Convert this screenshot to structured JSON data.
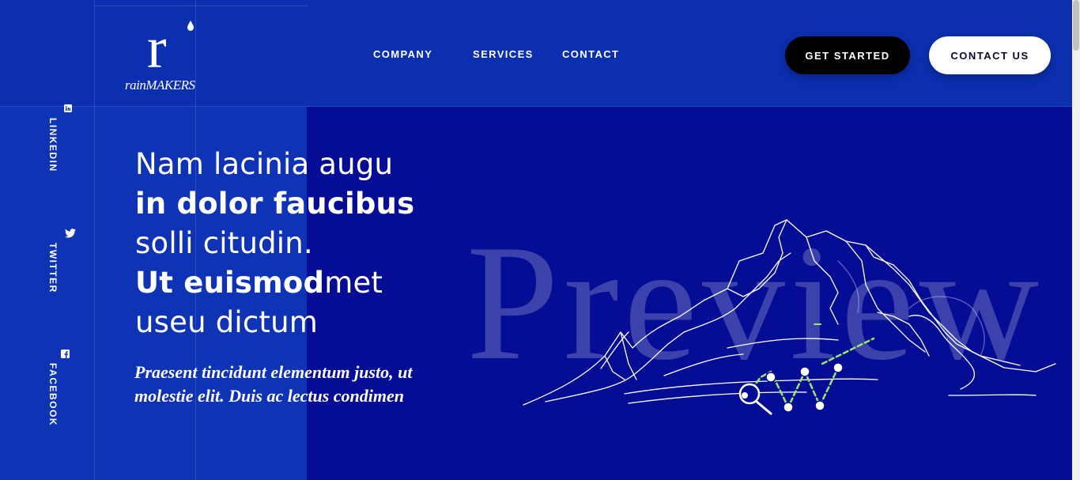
{
  "brand": {
    "logo_letter": "r",
    "logo_word": "rainMAKERS"
  },
  "nav": {
    "items": [
      "COMPANY",
      "SERVICES",
      "CONTACT"
    ]
  },
  "actions": {
    "get_started": "GET STARTED",
    "contact_us": "CONTACT US"
  },
  "social": [
    {
      "label": "LINKEDIN",
      "icon": "linkedin-icon"
    },
    {
      "label": "TWITTER",
      "icon": "twitter-icon"
    },
    {
      "label": "FACEBOOK",
      "icon": "facebook-icon"
    }
  ],
  "hero": {
    "line1": "Nam lacinia augu",
    "line2": "in dolor faucibus",
    "line3": "solli citudin.",
    "line4_bold": "Ut euismod",
    "line4_rest": "met",
    "line5": "useu dictum",
    "subtext": "Praesent tincidunt elementum justo, ut molestie elit. Duis ac lectus condimen"
  },
  "illustration": {
    "watermark": "Preview",
    "icon": "mountain-chart-search-illustration"
  },
  "colors": {
    "header_bg": "#0b2fae",
    "left_panel": "#0f33b5",
    "right_panel": "#060d95",
    "accent_line": "#9be86a"
  }
}
